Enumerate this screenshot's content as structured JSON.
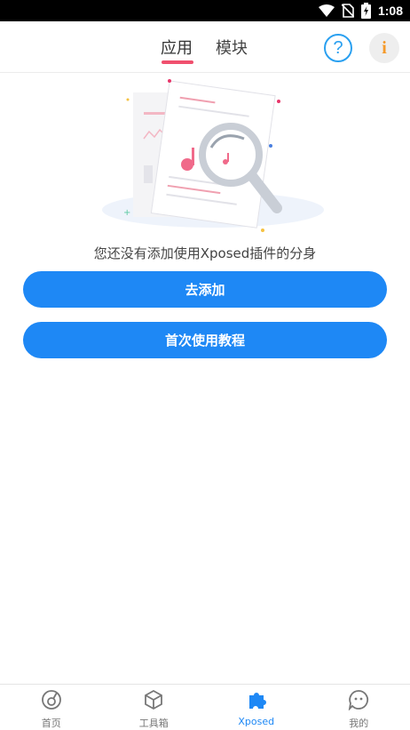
{
  "status_bar": {
    "time": "1:08",
    "icons": [
      "wifi-icon",
      "no-sim-icon",
      "battery-charging-icon"
    ]
  },
  "header": {
    "tabs": [
      {
        "label": "应用",
        "active": true
      },
      {
        "label": "模块",
        "active": false
      }
    ],
    "help_icon": "?",
    "info_icon": "i"
  },
  "main": {
    "empty_message": "您还没有添加使用Xposed插件的分身",
    "add_button": "去添加",
    "tutorial_button": "首次使用教程"
  },
  "bottom_nav": {
    "items": [
      {
        "label": "首页",
        "icon": "home-disc-icon",
        "active": false
      },
      {
        "label": "工具箱",
        "icon": "toolbox-cube-icon",
        "active": false
      },
      {
        "label": "Xposed",
        "icon": "puzzle-icon",
        "active": true
      },
      {
        "label": "我的",
        "icon": "profile-chat-icon",
        "active": false
      }
    ]
  },
  "colors": {
    "accent_blue": "#1e88f5",
    "tab_underline": "#f0506e",
    "info_orange": "#f59a2a",
    "help_blue": "#2aa0f0"
  }
}
